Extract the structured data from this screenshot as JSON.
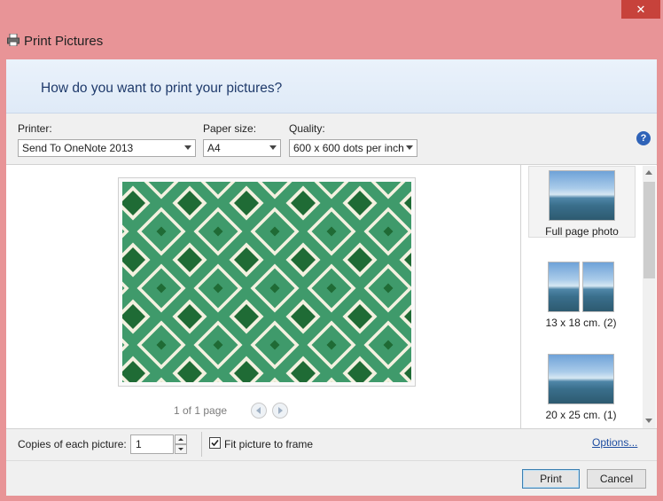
{
  "window": {
    "title": "Print Pictures",
    "close_glyph": "✕"
  },
  "header": {
    "question": "How do you want to print your pictures?"
  },
  "settings": {
    "printer": {
      "label": "Printer:",
      "value": "Send To OneNote 2013"
    },
    "paper_size": {
      "label": "Paper size:",
      "value": "A4"
    },
    "quality": {
      "label": "Quality:",
      "value": "600 x 600 dots per inch"
    },
    "help_glyph": "?"
  },
  "preview": {
    "page_info": "1 of 1 page"
  },
  "layouts": [
    {
      "label": "Full page photo",
      "selected": true
    },
    {
      "label": "13 x 18 cm. (2)",
      "selected": false
    },
    {
      "label": "20 x 25 cm. (1)",
      "selected": false
    }
  ],
  "options": {
    "copies_label": "Copies of each picture:",
    "copies_value": "1",
    "fit_label": "Fit picture to frame",
    "fit_checked": true,
    "options_link": "Options..."
  },
  "buttons": {
    "print": "Print",
    "cancel": "Cancel"
  },
  "colors": {
    "pattern_green": "#3f9a6b",
    "pattern_dark": "#1f6b35",
    "pattern_cream": "#f4f1e0"
  }
}
